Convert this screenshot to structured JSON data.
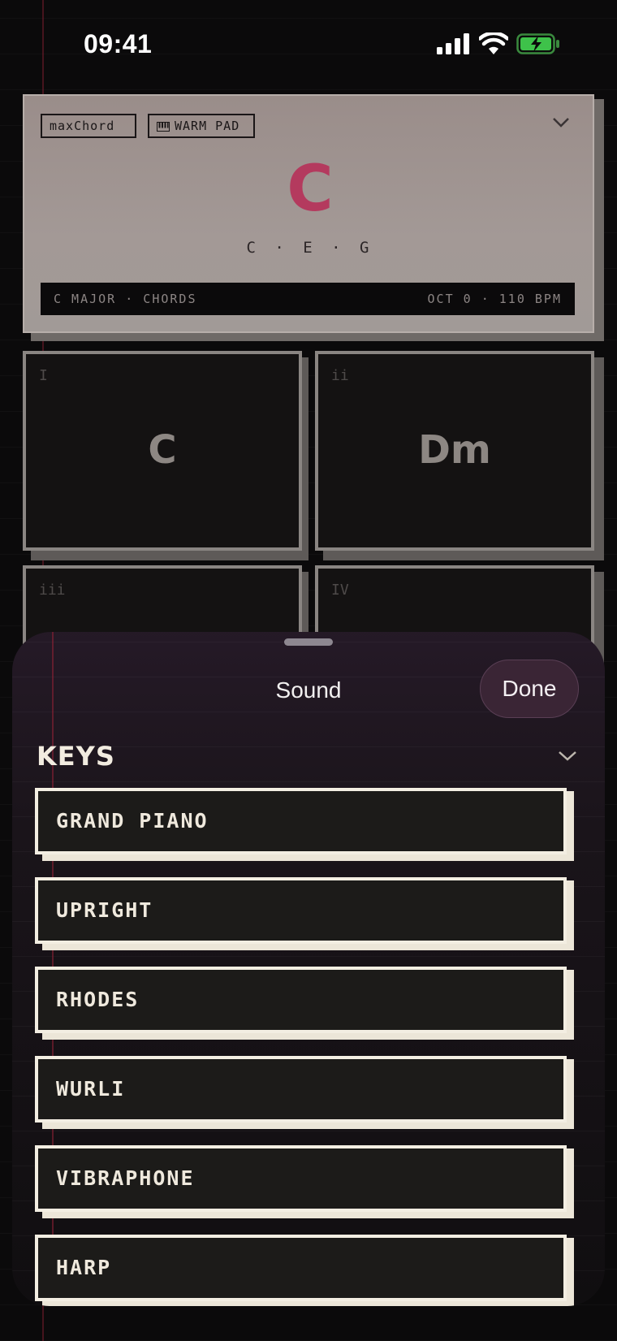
{
  "status": {
    "time": "09:41"
  },
  "header": {
    "brand_tag": "maxChord",
    "sound_tag": "WARM PAD",
    "chord": "C",
    "notes": "C · E · G",
    "info_left": "C MAJOR · CHORDS",
    "info_right": "OCT 0 · 110 BPM",
    "chord_color": "#b43a5e"
  },
  "pads": [
    {
      "numeral": "I",
      "chord": "C"
    },
    {
      "numeral": "ii",
      "chord": "Dm"
    },
    {
      "numeral": "iii",
      "chord": ""
    },
    {
      "numeral": "IV",
      "chord": ""
    }
  ],
  "sheet": {
    "title": "Sound",
    "done_label": "Done",
    "section": "KEYS",
    "items": [
      "GRAND PIANO",
      "UPRIGHT",
      "RHODES",
      "WURLI",
      "VIBRAPHONE",
      "HARP"
    ]
  }
}
